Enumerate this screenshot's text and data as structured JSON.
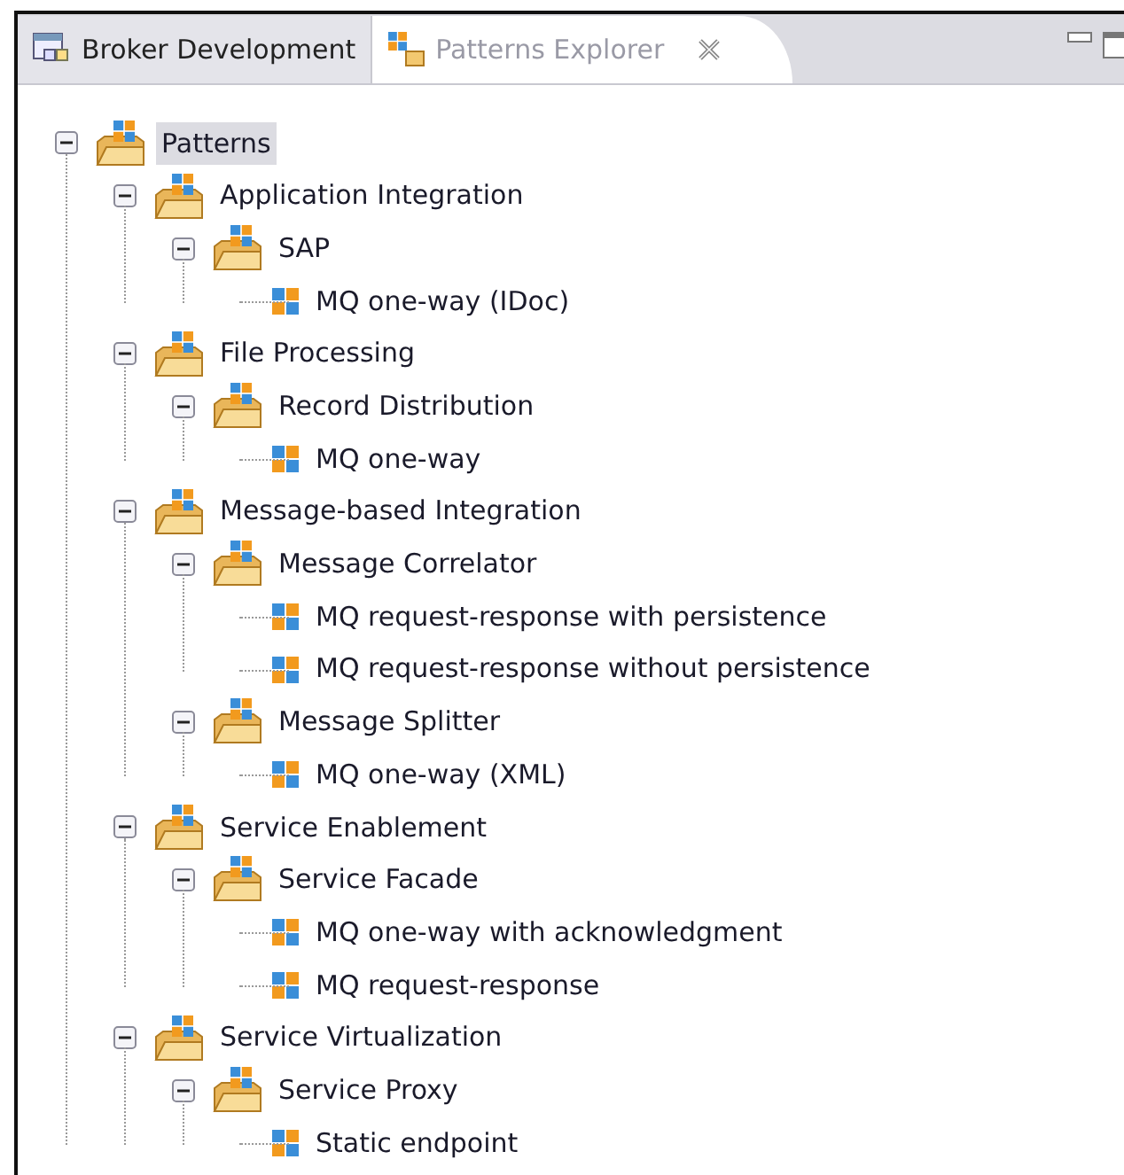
{
  "tabs": [
    {
      "label": "Broker Development",
      "selected": false,
      "closable": false
    },
    {
      "label": "Patterns Explorer",
      "selected": true,
      "closable": true
    }
  ],
  "tree": [
    {
      "label": "Patterns",
      "kind": "folder",
      "selected": true,
      "expanded": true,
      "children": [
        {
          "label": "Application Integration",
          "kind": "folder",
          "selected": false,
          "expanded": true,
          "children": [
            {
              "label": "SAP",
              "kind": "folder",
              "selected": false,
              "expanded": true,
              "children": [
                {
                  "label": "MQ one-way (IDoc)",
                  "kind": "pattern",
                  "selected": false
                }
              ]
            }
          ]
        },
        {
          "label": "File Processing",
          "kind": "folder",
          "selected": false,
          "expanded": true,
          "children": [
            {
              "label": "Record Distribution",
              "kind": "folder",
              "selected": false,
              "expanded": true,
              "children": [
                {
                  "label": "MQ one-way",
                  "kind": "pattern",
                  "selected": false
                }
              ]
            }
          ]
        },
        {
          "label": "Message-based Integration",
          "kind": "folder",
          "selected": false,
          "expanded": true,
          "children": [
            {
              "label": "Message Correlator",
              "kind": "folder",
              "selected": false,
              "expanded": true,
              "children": [
                {
                  "label": "MQ request-response with persistence",
                  "kind": "pattern",
                  "selected": false
                },
                {
                  "label": "MQ request-response without persistence",
                  "kind": "pattern",
                  "selected": false
                }
              ]
            },
            {
              "label": "Message Splitter",
              "kind": "folder",
              "selected": false,
              "expanded": true,
              "children": [
                {
                  "label": "MQ one-way (XML)",
                  "kind": "pattern",
                  "selected": false
                }
              ]
            }
          ]
        },
        {
          "label": "Service Enablement",
          "kind": "folder",
          "selected": false,
          "expanded": true,
          "children": [
            {
              "label": "Service Facade",
              "kind": "folder",
              "selected": false,
              "expanded": true,
              "children": [
                {
                  "label": "MQ one-way with acknowledgment",
                  "kind": "pattern",
                  "selected": false
                },
                {
                  "label": "MQ request-response",
                  "kind": "pattern",
                  "selected": false
                }
              ]
            }
          ]
        },
        {
          "label": "Service Virtualization",
          "kind": "folder",
          "selected": false,
          "expanded": true,
          "children": [
            {
              "label": "Service Proxy",
              "kind": "folder",
              "selected": false,
              "expanded": true,
              "children": [
                {
                  "label": "Static endpoint",
                  "kind": "pattern",
                  "selected": false
                }
              ]
            }
          ]
        }
      ]
    }
  ]
}
